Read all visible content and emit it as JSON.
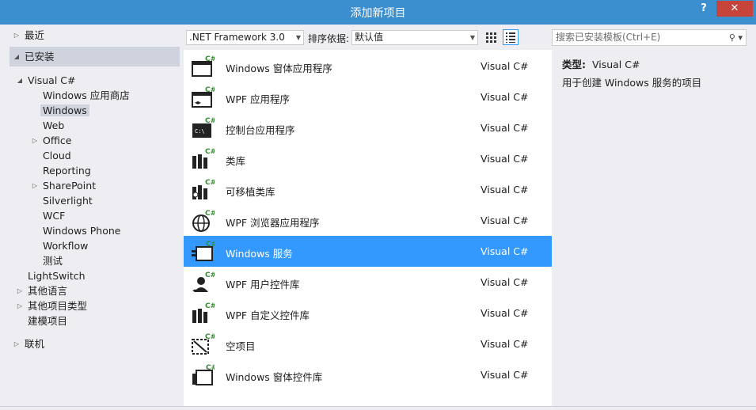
{
  "window": {
    "title": "添加新项目",
    "help_label": "?",
    "close_label": "✕"
  },
  "tree": {
    "recent": "最近",
    "installed": "已安装",
    "visual_csharp": "Visual C#",
    "children": [
      "Windows 应用商店",
      "Windows",
      "Web",
      "Office",
      "Cloud",
      "Reporting",
      "SharePoint",
      "Silverlight",
      "WCF",
      "Windows Phone",
      "Workflow",
      "测试"
    ],
    "lightswitch": "LightSwitch",
    "other_languages": "其他语言",
    "other_project_types": "其他项目类型",
    "modeling": "建模项目",
    "online": "联机"
  },
  "toolbar": {
    "framework": ".NET Framework 3.0",
    "sort_label": "排序依据:",
    "sort_value": "默认值",
    "search_placeholder": "搜索已安装模板(Ctrl+E)"
  },
  "templates": [
    {
      "name": "Windows 窗体应用程序",
      "lang": "Visual C#",
      "icon": "winforms-app-icon"
    },
    {
      "name": "WPF 应用程序",
      "lang": "Visual C#",
      "icon": "wpf-app-icon"
    },
    {
      "name": "控制台应用程序",
      "lang": "Visual C#",
      "icon": "console-app-icon"
    },
    {
      "name": "类库",
      "lang": "Visual C#",
      "icon": "class-library-icon"
    },
    {
      "name": "可移植类库",
      "lang": "Visual C#",
      "icon": "portable-library-icon"
    },
    {
      "name": "WPF 浏览器应用程序",
      "lang": "Visual C#",
      "icon": "wpf-browser-app-icon"
    },
    {
      "name": "Windows 服务",
      "lang": "Visual C#",
      "icon": "windows-service-icon"
    },
    {
      "name": "WPF 用户控件库",
      "lang": "Visual C#",
      "icon": "wpf-user-control-icon"
    },
    {
      "name": "WPF 自定义控件库",
      "lang": "Visual C#",
      "icon": "wpf-custom-control-icon"
    },
    {
      "name": "空项目",
      "lang": "Visual C#",
      "icon": "empty-project-icon"
    },
    {
      "name": "Windows 窗体控件库",
      "lang": "Visual C#",
      "icon": "winforms-control-library-icon"
    }
  ],
  "detail": {
    "type_label": "类型:",
    "type_value": "Visual C#",
    "description": "用于创建 Windows 服务的项目"
  },
  "colors": {
    "titlebar": "#3c8fce",
    "selection": "#3399ff",
    "close": "#c7443b",
    "csharp_badge": "#388a34"
  }
}
